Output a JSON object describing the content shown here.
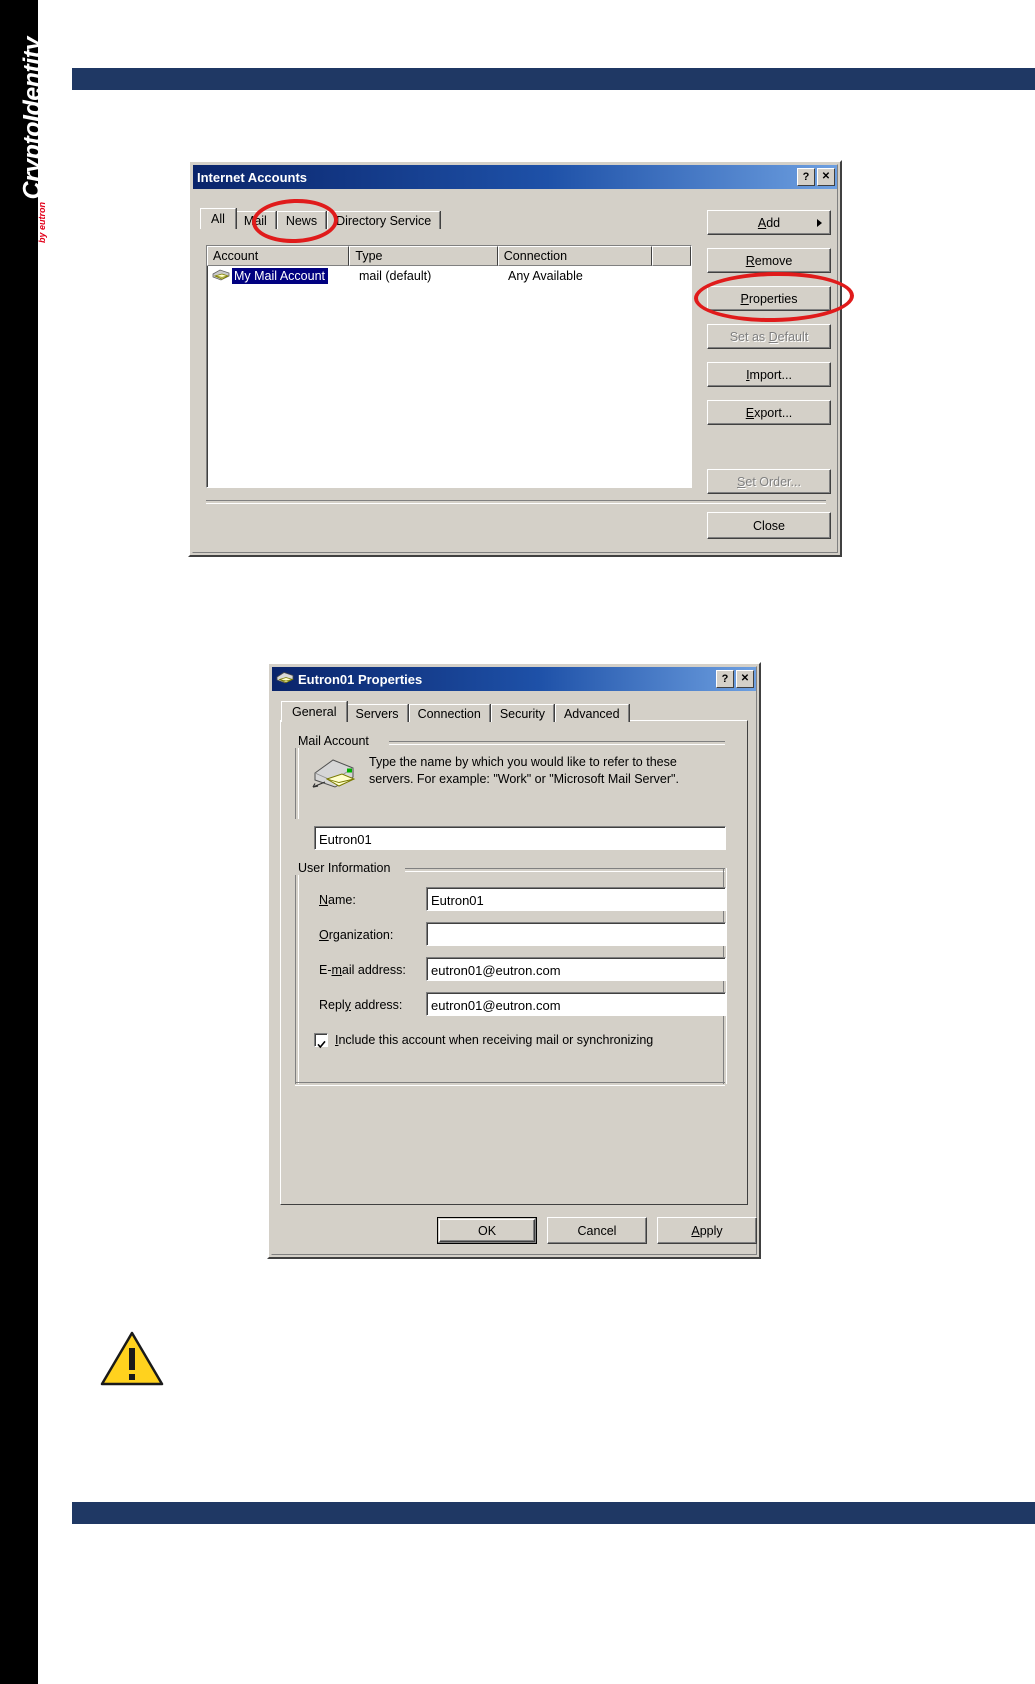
{
  "page": {
    "brand": "CryptoIdentity",
    "brand_sub": "by eutron",
    "warning_icon": "warning-triangle-icon"
  },
  "internet_accounts": {
    "title": "Internet Accounts",
    "title_icon": "window-icon",
    "help_button": "?",
    "close_button": "✕",
    "tabs": [
      {
        "label": "All",
        "active": false
      },
      {
        "label": "Mail",
        "active": true
      },
      {
        "label": "News",
        "active": false
      },
      {
        "label": "Directory Service",
        "active": false
      }
    ],
    "columns": [
      "Account",
      "Type",
      "Connection"
    ],
    "rows": [
      {
        "icon": "mail-account-icon",
        "account": "My Mail Account",
        "type": "mail (default)",
        "connection": "Any Available",
        "selected": true
      }
    ],
    "buttons": [
      {
        "label": "Add",
        "underline": "A",
        "disabled": false,
        "arrow": true,
        "name": "add-button"
      },
      {
        "label": "Remove",
        "underline": "R",
        "disabled": false,
        "arrow": false,
        "name": "remove-button"
      },
      {
        "label": "Properties",
        "underline": "P",
        "disabled": false,
        "arrow": false,
        "name": "properties-button"
      },
      {
        "label": "Set as Default",
        "underline": "D",
        "disabled": true,
        "arrow": false,
        "name": "set-as-default-button"
      },
      {
        "label": "Import...",
        "underline": "I",
        "disabled": false,
        "arrow": false,
        "name": "import-button"
      },
      {
        "label": "Export...",
        "underline": "E",
        "disabled": false,
        "arrow": false,
        "name": "export-button"
      },
      {
        "label": "Set Order...",
        "underline": "S",
        "disabled": true,
        "arrow": false,
        "name": "set-order-button"
      }
    ],
    "close_label": "Close",
    "annotations": [
      "mail-tab-highlight-ellipse",
      "properties-button-highlight-ellipse"
    ]
  },
  "account_properties": {
    "title": "Eutron01 Properties",
    "title_icon": "mail-account-icon",
    "help_button": "?",
    "close_button": "✕",
    "tabs": [
      {
        "label": "General",
        "active": true
      },
      {
        "label": "Servers",
        "active": false
      },
      {
        "label": "Connection",
        "active": false
      },
      {
        "label": "Security",
        "active": false
      },
      {
        "label": "Advanced",
        "active": false
      }
    ],
    "mail_account": {
      "group_label": "Mail Account",
      "icon": "mail-server-icon",
      "description": "Type the name by which you would like to refer to these servers.  For example: \"Work\" or \"Microsoft Mail Server\".",
      "value": "Eutron01"
    },
    "user_information": {
      "group_label": "User Information",
      "fields": [
        {
          "label": "Name:",
          "underline": "N",
          "value": "Eutron01",
          "name": "name-field"
        },
        {
          "label": "Organization:",
          "underline": "O",
          "value": "",
          "name": "organization-field"
        },
        {
          "label": "E-mail address:",
          "underline": "m",
          "value": "eutron01@eutron.com",
          "name": "email-address-field"
        },
        {
          "label": "Reply address:",
          "underline": "y",
          "value": "eutron01@eutron.com",
          "name": "reply-address-field"
        }
      ]
    },
    "include_checkbox": {
      "label": "Include this account when receiving mail or synchronizing",
      "underline": "I",
      "checked": true
    },
    "buttons": [
      {
        "label": "OK",
        "default": true,
        "name": "ok-button"
      },
      {
        "label": "Cancel",
        "default": false,
        "name": "cancel-button"
      },
      {
        "label": "Apply",
        "underline": "A",
        "default": false,
        "name": "apply-button"
      }
    ]
  },
  "colors": {
    "dialog_face": "#d4d0c8",
    "title_gradient_start": "#0a246a",
    "title_gradient_end": "#6d9fe0",
    "selection": "#000080",
    "annotation_red": "#e01b1b",
    "rule_blue": "#1f3864",
    "brand_red": "#e2001a"
  }
}
